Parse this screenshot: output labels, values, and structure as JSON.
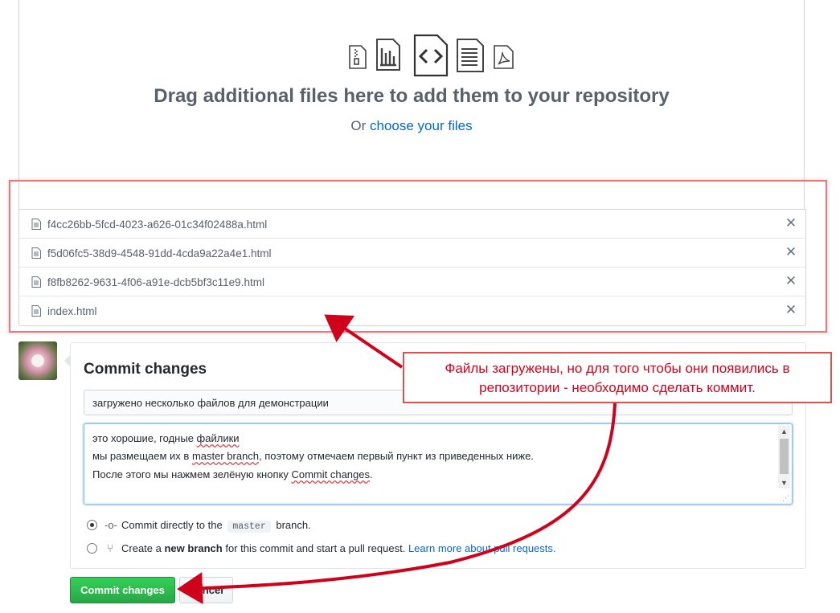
{
  "dropzone": {
    "title": "Drag additional files here to add them to your repository",
    "prefix": "Or ",
    "choose_link": "choose your files"
  },
  "files": [
    {
      "name": "f4cc26bb-5fcd-4023-a626-01c34f02488a.html",
      "icon": "file-icon"
    },
    {
      "name": "f5d06fc5-38d9-4548-91dd-4cda9a22a4e1.html",
      "icon": "file-icon"
    },
    {
      "name": "f8fb8262-9631-4f06-a91e-dcb5bf3c11e9.html",
      "icon": "file-icon"
    },
    {
      "name": "index.html",
      "icon": "file-icon"
    }
  ],
  "commit": {
    "title": "Commit changes",
    "summary_value": "загружено несколько файлов для демонстрации",
    "description": {
      "line1_a": "это хорошие, годные ",
      "line1_b": "файлики",
      "line2_a": "мы размещаем их в ",
      "line2_b": "master branch",
      "line2_c": ",  поэтому отмечаем первый пункт из приведенных ниже.",
      "line3_a": "После этого мы нажмем зелёную кнопку ",
      "line3_b": "Commit changes",
      "line3_c": "."
    },
    "option_direct": {
      "prefix": "Commit directly to the",
      "branch": "master",
      "suffix": "branch."
    },
    "option_new": {
      "prefix": "Create a ",
      "bold": "new branch",
      "middle": " for this commit and start a pull request. ",
      "link": "Learn more about pull requests."
    },
    "commit_button": "Commit changes",
    "cancel_button": "Cancel"
  },
  "annotation": {
    "line1": "Файлы загружены, но для того чтобы они появились в",
    "line2": "репозитории - необходимо сделать коммит."
  },
  "colors": {
    "accent_link": "#0366d6",
    "commit_green": "#28a745",
    "annotation_red": "#d0021b",
    "highlight_frame": "#e8797b"
  }
}
